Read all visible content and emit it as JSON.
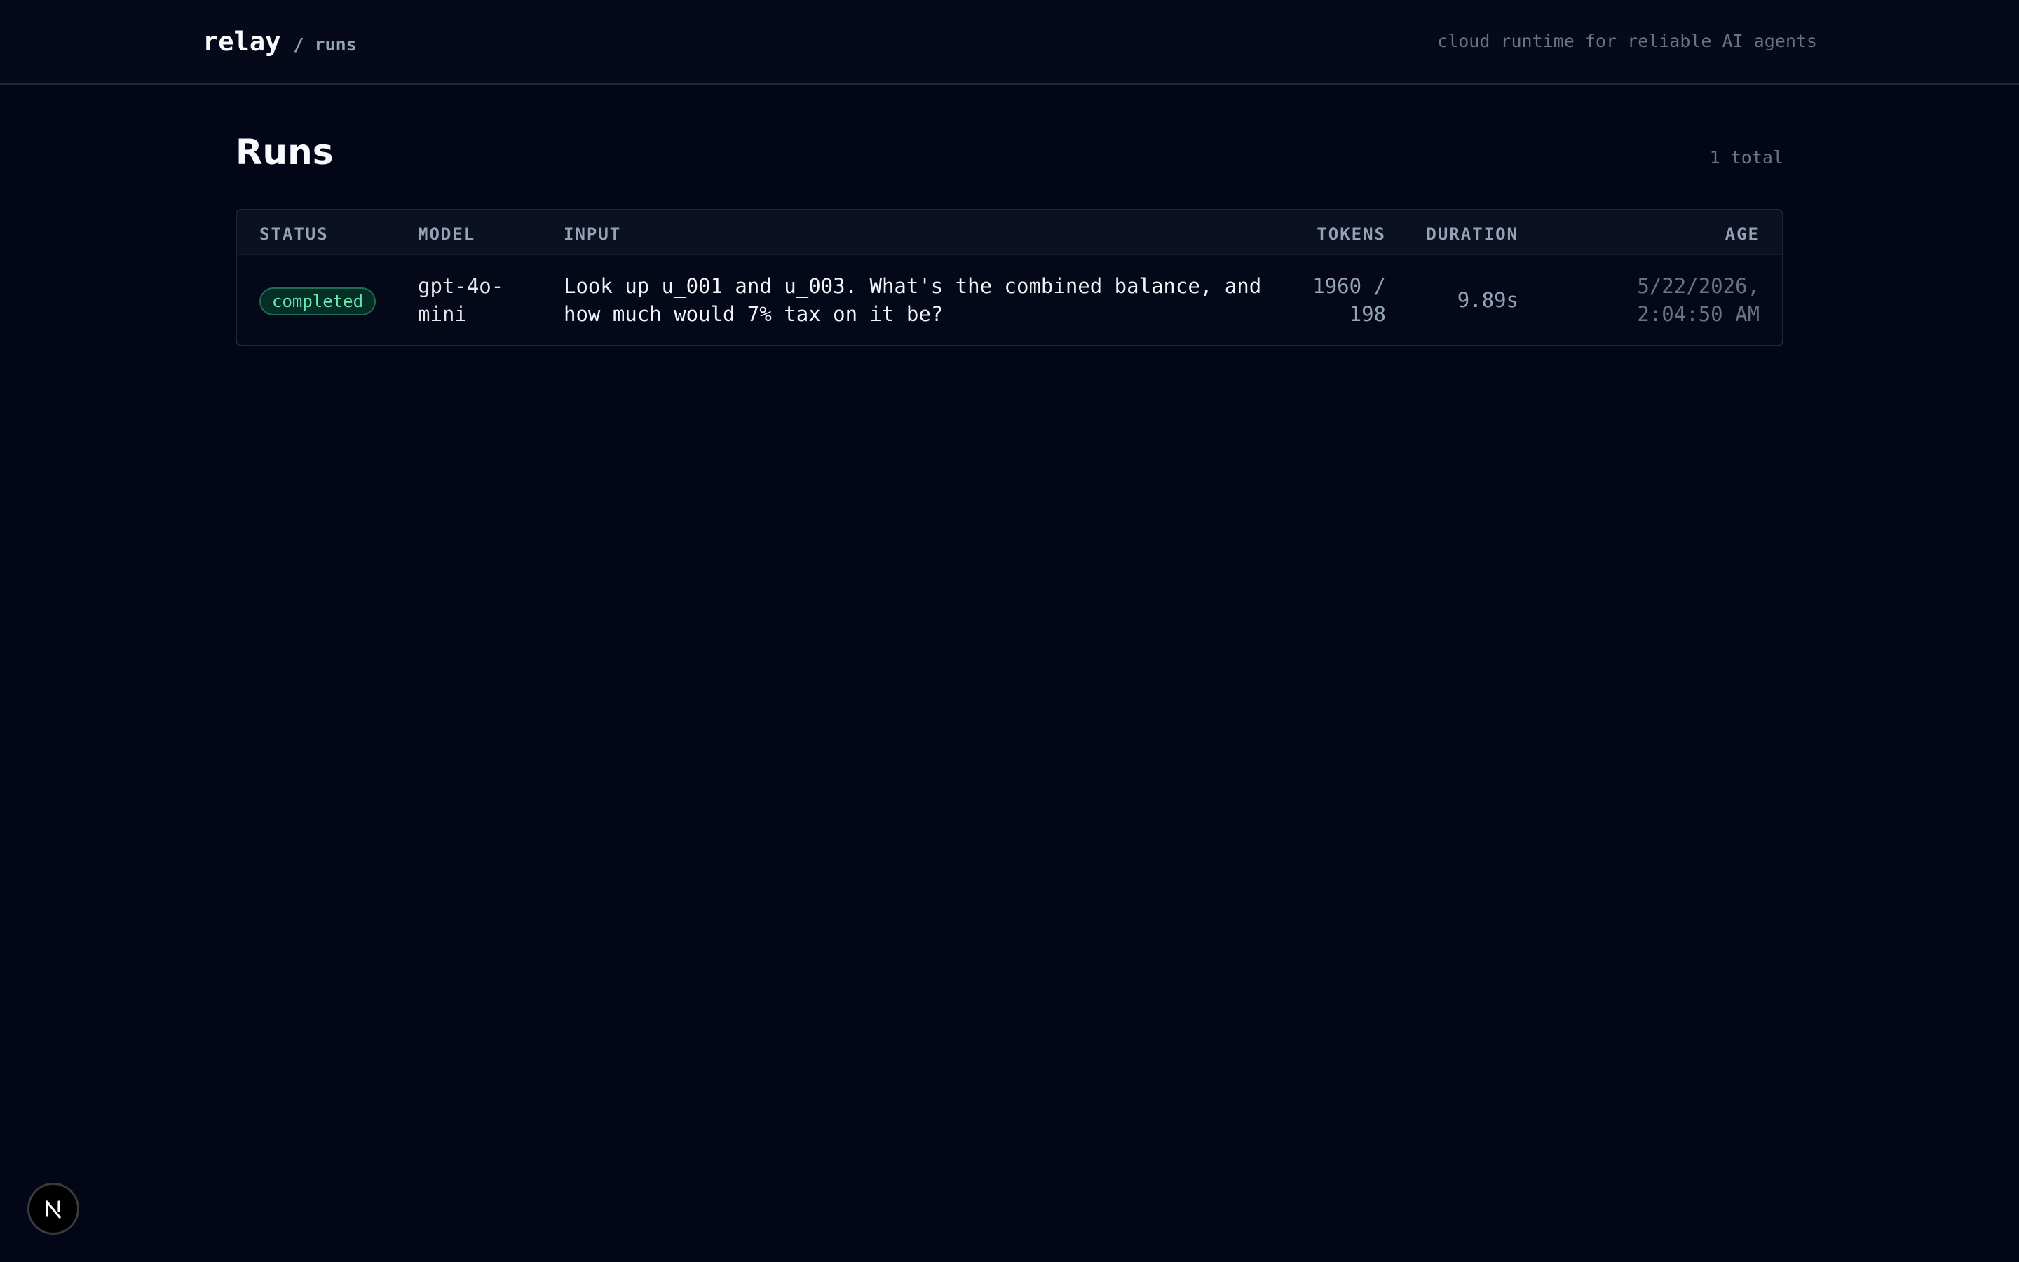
{
  "header": {
    "brand": "relay",
    "breadcrumb": "/ runs",
    "tagline": "cloud runtime for reliable AI agents"
  },
  "page": {
    "title": "Runs",
    "total": "1 total"
  },
  "table": {
    "columns": [
      "STATUS",
      "MODEL",
      "INPUT",
      "TOKENS",
      "DURATION",
      "AGE"
    ],
    "rows": [
      {
        "status": "completed",
        "model_line1": "gpt-4o-",
        "model_line2": "mini",
        "input_line1": "Look up u_001 and u_003. What's the combined balance, and",
        "input_line2": "how much would 7% tax on it be?",
        "tokens_line1": "1960 /",
        "tokens_line2": "198",
        "duration": "9.89s",
        "age_line1": "5/22/2026,",
        "age_line2": "2:04:50 AM"
      }
    ]
  },
  "dev_indicator": {
    "icon": "nextjs-logo-icon"
  },
  "colors": {
    "background": "#030617",
    "status_completed": "#6ee7b7"
  }
}
